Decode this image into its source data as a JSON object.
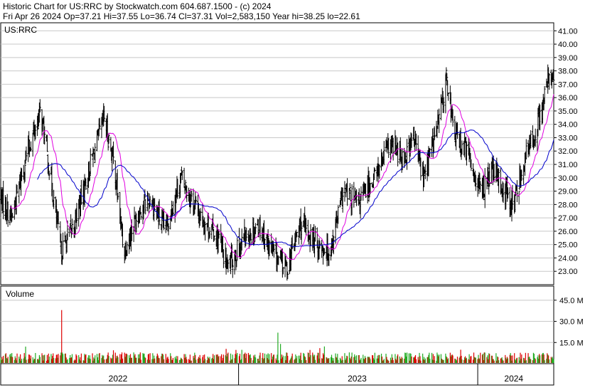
{
  "header": {
    "line1": "Historic Chart for US:RRC by Stockwatch.com 604.687.1500 - (c) 2024",
    "line2": "Fri Apr 26 2024   Op=37.21   Hi=37.55   Lo=36.74   Cl=37.31   Vol=2,583,150   Year hi=38.25   lo=22.61"
  },
  "colors": {
    "background": "#ffffff",
    "price_bars": "#000000",
    "ma_short": "#e000e0",
    "ma_long": "#0000cc",
    "volume_up": "#22aa22",
    "volume_down": "#dd0000",
    "grid": "#c8c8c8",
    "frame": "#000000"
  },
  "chart_data": [
    {
      "type": "ohlc",
      "ticker_label": "US:RRC",
      "price_ticks": [
        "23.00",
        "24.00",
        "25.00",
        "26.00",
        "27.00",
        "28.00",
        "29.00",
        "30.00",
        "31.00",
        "32.00",
        "33.00",
        "34.00",
        "35.00",
        "36.00",
        "37.00",
        "38.00",
        "39.00",
        "40.00",
        "41.00"
      ],
      "ylim": [
        22.0,
        41.6
      ],
      "period": {
        "start": "2022-01-03",
        "end": "2024-04-26"
      },
      "grid": true,
      "close_anchors": [
        {
          "date": "2022-01-03",
          "close": 28.5
        },
        {
          "date": "2022-01-20",
          "close": 27.0
        },
        {
          "date": "2022-02-10",
          "close": 31.5
        },
        {
          "date": "2022-03-05",
          "close": 35.0
        },
        {
          "date": "2022-03-20",
          "close": 30.0
        },
        {
          "date": "2022-04-05",
          "close": 24.5
        },
        {
          "date": "2022-04-25",
          "close": 26.5
        },
        {
          "date": "2022-05-20",
          "close": 31.0
        },
        {
          "date": "2022-06-10",
          "close": 34.5
        },
        {
          "date": "2022-06-25",
          "close": 31.0
        },
        {
          "date": "2022-07-10",
          "close": 24.5
        },
        {
          "date": "2022-08-01",
          "close": 27.5
        },
        {
          "date": "2022-08-20",
          "close": 28.5
        },
        {
          "date": "2022-09-10",
          "close": 26.0
        },
        {
          "date": "2022-10-05",
          "close": 30.0
        },
        {
          "date": "2022-11-05",
          "close": 27.0
        },
        {
          "date": "2022-12-01",
          "close": 25.5
        },
        {
          "date": "2022-12-15",
          "close": 23.3
        },
        {
          "date": "2023-01-10",
          "close": 25.5
        },
        {
          "date": "2023-02-01",
          "close": 26.5
        },
        {
          "date": "2023-02-20",
          "close": 24.5
        },
        {
          "date": "2023-03-15",
          "close": 23.2
        },
        {
          "date": "2023-04-05",
          "close": 26.5
        },
        {
          "date": "2023-05-01",
          "close": 25.0
        },
        {
          "date": "2023-05-20",
          "close": 24.5
        },
        {
          "date": "2023-06-10",
          "close": 29.0
        },
        {
          "date": "2023-07-01",
          "close": 28.0
        },
        {
          "date": "2023-08-01",
          "close": 30.5
        },
        {
          "date": "2023-08-20",
          "close": 32.5
        },
        {
          "date": "2023-09-10",
          "close": 31.5
        },
        {
          "date": "2023-09-25",
          "close": 33.0
        },
        {
          "date": "2023-10-10",
          "close": 30.0
        },
        {
          "date": "2023-11-01",
          "close": 34.0
        },
        {
          "date": "2023-11-15",
          "close": 37.5
        },
        {
          "date": "2023-11-25",
          "close": 33.5
        },
        {
          "date": "2023-12-15",
          "close": 32.0
        },
        {
          "date": "2024-01-05",
          "close": 29.0
        },
        {
          "date": "2024-01-25",
          "close": 30.5
        },
        {
          "date": "2024-02-10",
          "close": 29.0
        },
        {
          "date": "2024-02-25",
          "close": 28.0
        },
        {
          "date": "2024-03-10",
          "close": 31.0
        },
        {
          "date": "2024-03-25",
          "close": 33.0
        },
        {
          "date": "2024-04-10",
          "close": 35.5
        },
        {
          "date": "2024-04-20",
          "close": 38.0
        },
        {
          "date": "2024-04-26",
          "close": 37.31
        }
      ],
      "moving_averages": [
        "ma_short",
        "ma_long"
      ]
    },
    {
      "type": "bar",
      "panel_label": "Volume",
      "volume_ticks": [
        {
          "label": "15.0 M",
          "value": 15.0
        },
        {
          "label": "30.0 M",
          "value": 30.0
        },
        {
          "label": "45.0 M",
          "value": 45.0
        }
      ],
      "ylim_millions": [
        0,
        55
      ],
      "volume_spikes_millions": [
        {
          "date": "2022-04-06",
          "volume": 38.0
        },
        {
          "date": "2023-03-02",
          "volume": 22.0
        },
        {
          "date": "2023-03-06",
          "volume": 14.0
        }
      ],
      "typical_volume_millions": [
        2.0,
        8.0
      ]
    }
  ],
  "x_axis": {
    "year_labels": [
      {
        "label": "2022",
        "date": "2022-07-01"
      },
      {
        "label": "2023",
        "date": "2023-07-01"
      },
      {
        "label": "2024",
        "date": "2024-02-25"
      }
    ],
    "year_boundaries": [
      "2023-01-01",
      "2024-01-01"
    ]
  }
}
